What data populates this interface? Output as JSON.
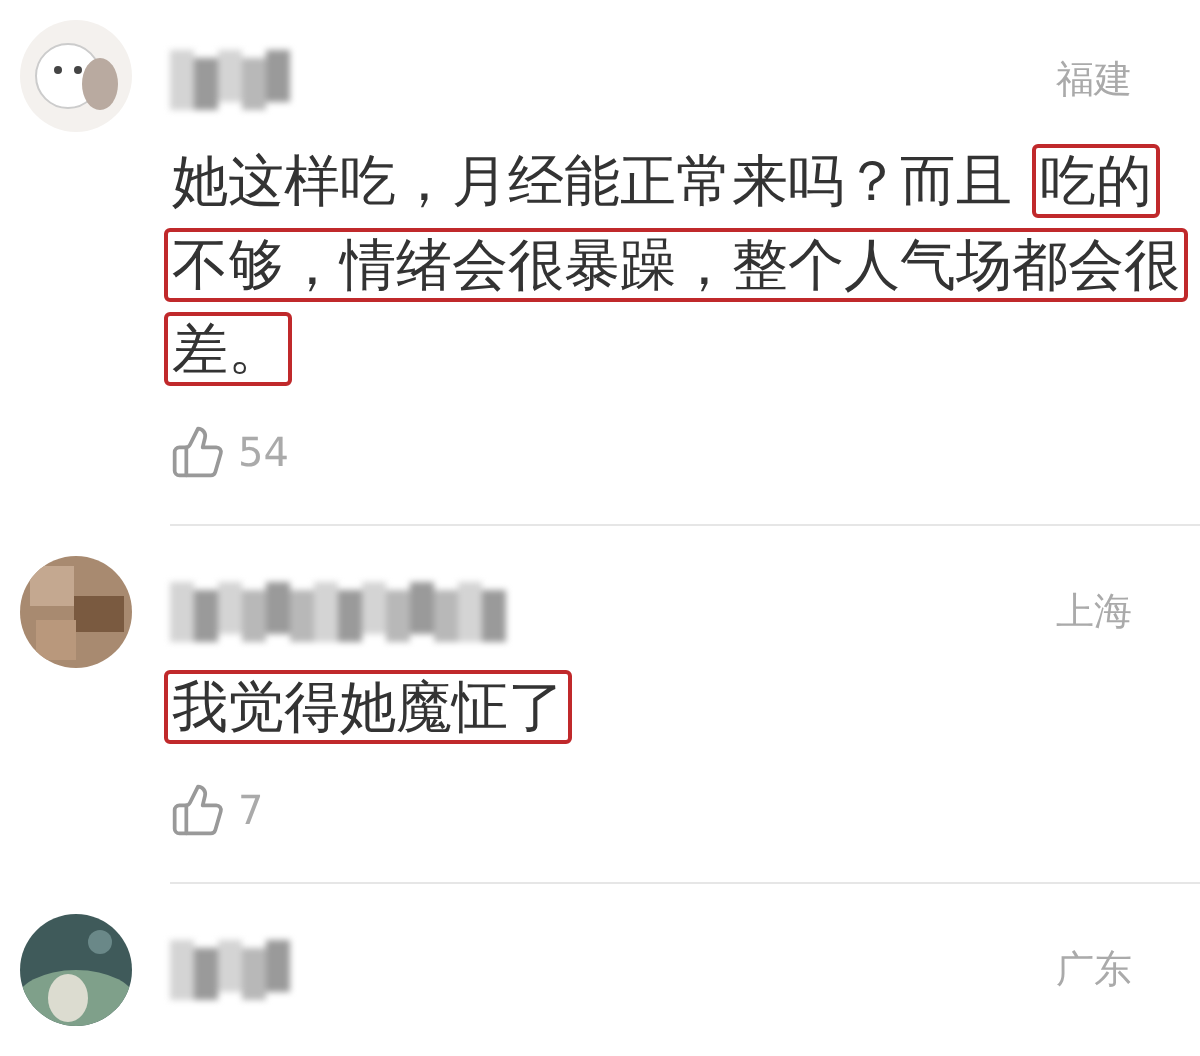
{
  "comments": [
    {
      "location": "福建",
      "lines": [
        [
          {
            "text": "她这样吃，月经能正常来吗？而且",
            "highlighted": false
          },
          {
            "text": "吃的",
            "highlighted": true
          }
        ],
        [
          {
            "text": "不够，情绪会很暴躁，整个人气场都会很",
            "highlighted": true
          }
        ],
        [
          {
            "text": "差。",
            "highlighted": true
          }
        ]
      ],
      "likes": "54"
    },
    {
      "location": "上海",
      "lines": [
        [
          {
            "text": "我觉得她魔怔了",
            "highlighted": true
          }
        ]
      ],
      "likes": "7"
    },
    {
      "location": "广东"
    }
  ]
}
